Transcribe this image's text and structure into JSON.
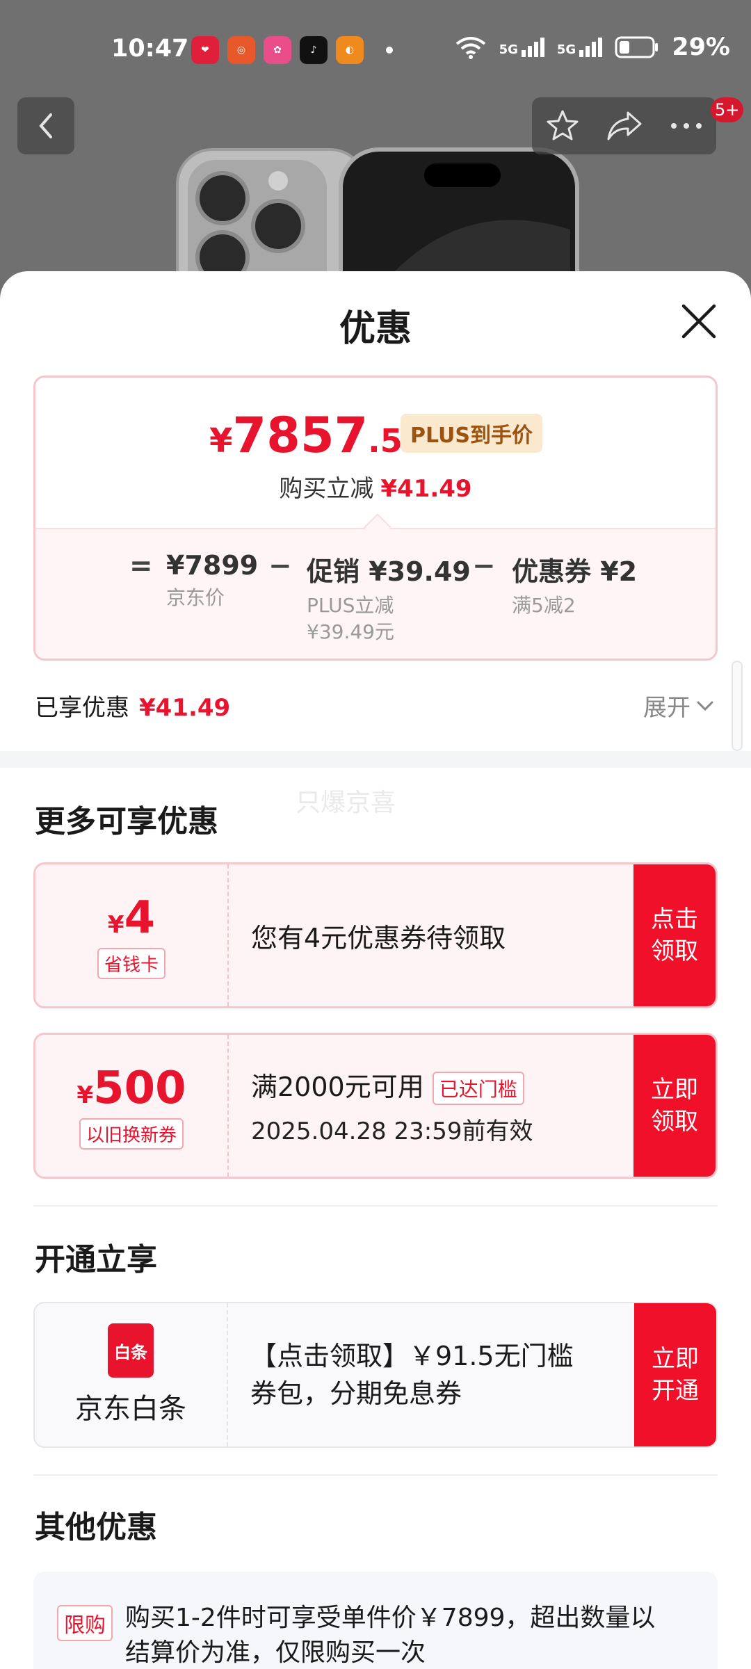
{
  "status_bar": {
    "time": "10:47",
    "network_1": "5G",
    "network_2": "5G",
    "battery": "29%"
  },
  "header": {
    "badge": "5+"
  },
  "sheet": {
    "title": "优惠"
  },
  "price_card": {
    "yen": "¥",
    "price_int": "7857",
    "price_dec": ".51",
    "plus_tag": "PLUS到手价",
    "reduce_label": "购买立减",
    "reduce_value": "¥41.49",
    "equals": "=",
    "minus": "−",
    "jd_price": "¥7899",
    "jd_price_label": "京东价",
    "promo": "促销 ¥39.49",
    "promo_sub_1": "PLUS立减",
    "promo_sub_2": "¥39.49元",
    "coupon": "优惠券 ¥2",
    "coupon_sub": "满5减2"
  },
  "enjoyed": {
    "label": "已享优惠",
    "value": "¥41.49",
    "expand": "展开"
  },
  "more_section": {
    "title": "更多可享优惠",
    "watermark": "只爆京喜",
    "coupon1": {
      "yen": "¥",
      "amount": "4",
      "tag": "省钱卡",
      "desc": "您有4元优惠券待领取",
      "action_1": "点击",
      "action_2": "领取"
    },
    "coupon2": {
      "yen": "¥",
      "amount": "500",
      "tag": "以旧换新券",
      "desc": "满2000元可用",
      "reach_tag": "已达门槛",
      "validity": "2025.04.28 23:59前有效",
      "action_1": "立即",
      "action_2": "领取"
    }
  },
  "open_section": {
    "title": "开通立享",
    "icon_text": "白条",
    "name": "京东白条",
    "desc_1": "【点击领取】￥91.5无门槛",
    "desc_2": "券包，分期免息券",
    "action_1": "立即",
    "action_2": "开通"
  },
  "other_section": {
    "title": "其他优惠",
    "tag": "限购",
    "text_1": "购买1-2件时可享受单件价￥7899，超出数量以",
    "text_2": "结算价为准，仅限购买一次"
  },
  "colors": {
    "accent_red": "#e8142e",
    "button_red": "#f0102a",
    "plus_gold": "#9a5310"
  }
}
